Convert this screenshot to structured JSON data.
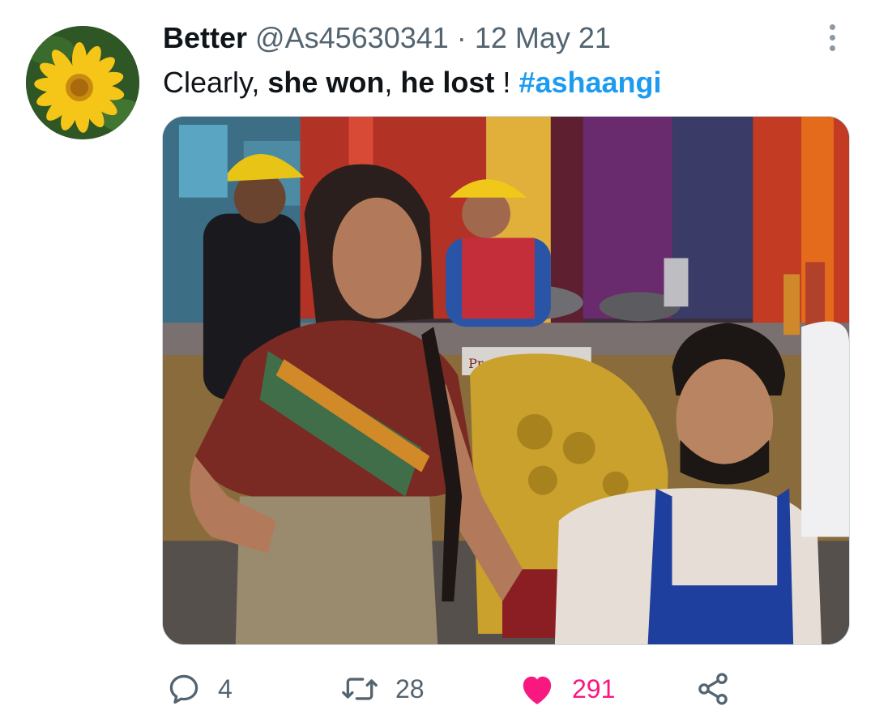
{
  "tweet": {
    "author_name": "Better",
    "author_handle": "@As45630341",
    "separator": "·",
    "date": "12 May 21",
    "text_plain_1": "Clearly, ",
    "text_bold_1": "she won",
    "text_plain_2": ", ",
    "text_bold_2": "he lost",
    "text_plain_3": " ! ",
    "hashtag": "#ashaangi",
    "media_sign_text": "Preethi"
  },
  "actions": {
    "reply_count": "4",
    "retweet_count": "28",
    "like_count": "291"
  },
  "icons": {
    "more": "more-vertical-icon",
    "reply": "reply-icon",
    "retweet": "retweet-icon",
    "like": "heart-icon",
    "share": "share-icon"
  },
  "colors": {
    "accent": "#1d9bf0",
    "like": "#f91880",
    "secondary_text": "#536471"
  }
}
